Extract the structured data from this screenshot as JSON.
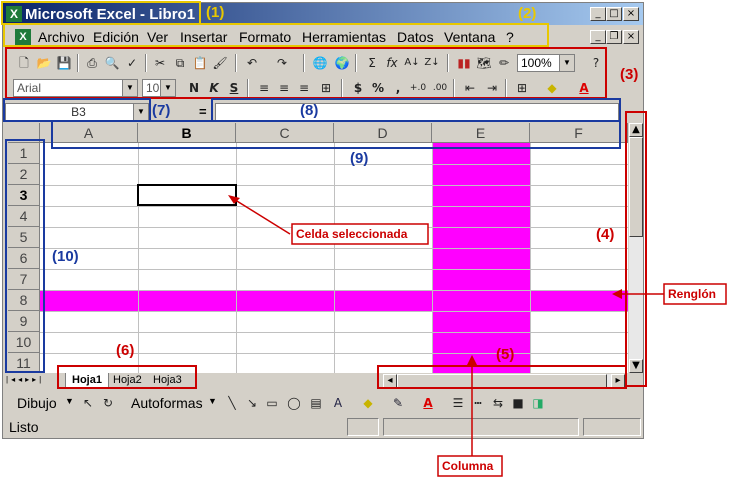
{
  "window": {
    "title": "Microsoft Excel - Libro1"
  },
  "menu": [
    "Archivo",
    "Edición",
    "Ver",
    "Insertar",
    "Formato",
    "Herramientas",
    "Datos",
    "Ventana",
    "?"
  ],
  "format_bar": {
    "font": "Arial",
    "size": "10",
    "bold": "N",
    "italic": "K",
    "underline": "S",
    "zoom": "100%"
  },
  "formula_bar": {
    "name_box": "B3",
    "equals": "="
  },
  "columns": [
    "A",
    "B",
    "C",
    "D",
    "E",
    "F"
  ],
  "rows": [
    "1",
    "2",
    "3",
    "4",
    "5",
    "6",
    "7",
    "8",
    "9",
    "10",
    "11"
  ],
  "sheets": [
    "Hoja1",
    "Hoja2",
    "Hoja3"
  ],
  "drawing_bar": {
    "draw_label": "Dibujo",
    "autoshapes_label": "Autoformas"
  },
  "status": {
    "text": "Listo"
  },
  "annotations": {
    "a1": "(1)",
    "a2": "(2)",
    "a3": "(3)",
    "a4": "(4)",
    "a5": "(5)",
    "a6": "(6)",
    "a7": "(7)",
    "a8": "(8)",
    "a9": "(9)",
    "a10": "(10)",
    "selected_cell": "Celda seleccionada",
    "row": "Renglón",
    "column": "Columna"
  },
  "colors": {
    "highlight": "#ff00ff",
    "title_bar": "#0a246a",
    "annotation_red": "#cc0000",
    "annotation_blue": "#1a3aa0",
    "annotation_yellow": "#e8c800"
  }
}
